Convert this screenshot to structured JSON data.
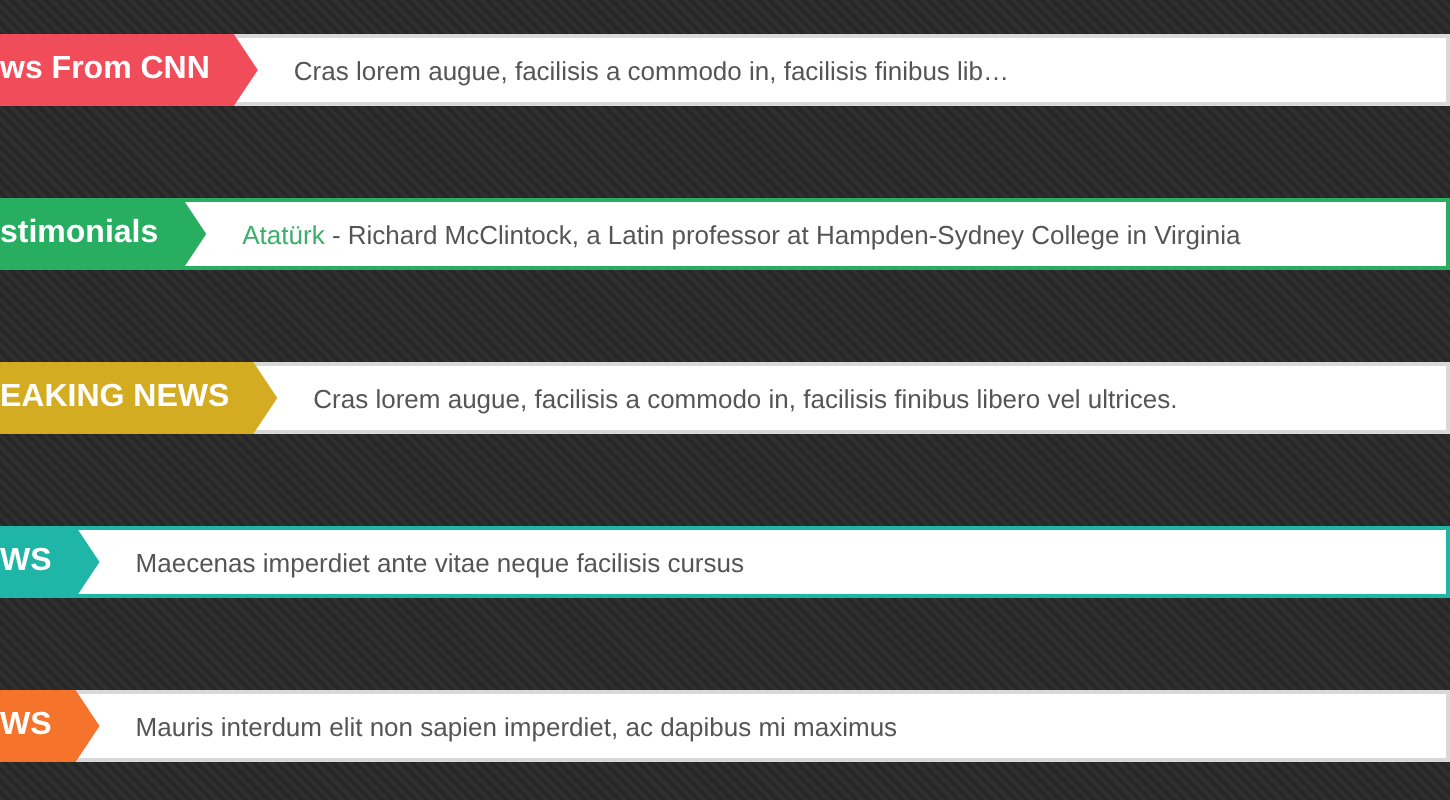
{
  "tickers": [
    {
      "label": "ws From CNN",
      "color": "#f04c5a",
      "accent_border": false,
      "text": "Cras lorem augue, facilisis a commodo in, facilisis finibus lib…"
    },
    {
      "label": "stimonials",
      "color": "#27ae60",
      "accent_border": true,
      "source": "Atatürk",
      "text": " - Richard McClintock, a Latin professor at Hampden-Sydney College in Virginia"
    },
    {
      "label": "EAKING NEWS",
      "color": "#d4ac22",
      "accent_border": false,
      "text": "Cras lorem augue, facilisis a commodo in, facilisis finibus libero vel ultrices."
    },
    {
      "label": "WS",
      "color": "#1fb5a7",
      "accent_border": true,
      "text": "Maecenas imperdiet ante vitae neque facilisis cursus"
    },
    {
      "label": "WS",
      "color": "#f5732a",
      "accent_border": false,
      "text": "Mauris interdum elit non sapien imperdiet, ac dapibus mi maximus"
    }
  ]
}
